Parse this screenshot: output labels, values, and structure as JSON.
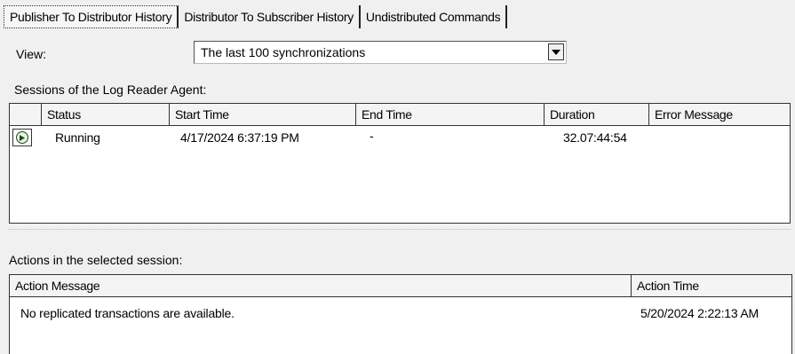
{
  "tabs": [
    {
      "label": "Publisher To Distributor History",
      "active": true
    },
    {
      "label": "Distributor To Subscriber History",
      "active": false
    },
    {
      "label": "Undistributed Commands",
      "active": false
    }
  ],
  "view": {
    "label": "View:",
    "selected": "The last 100 synchronizations"
  },
  "sessions": {
    "label": "Sessions of the Log Reader Agent:",
    "columns": [
      "Status",
      "Start Time",
      "End Time",
      "Duration",
      "Error Message"
    ],
    "rows": [
      {
        "status_icon": "running-icon",
        "status": "Running",
        "start_time": "4/17/2024 6:37:19 PM",
        "end_time": "-",
        "duration": "32.07:44:54",
        "error_message": ""
      }
    ]
  },
  "actions": {
    "label": "Actions in the selected session:",
    "columns": [
      "Action Message",
      "Action Time"
    ],
    "rows": [
      {
        "message": "No replicated transactions are available.",
        "time": "5/20/2024 2:22:13 AM"
      }
    ]
  },
  "colors": {
    "background": "#f0f0f0",
    "grid": "#ffffff",
    "status_icon": "#1a4a1a"
  }
}
